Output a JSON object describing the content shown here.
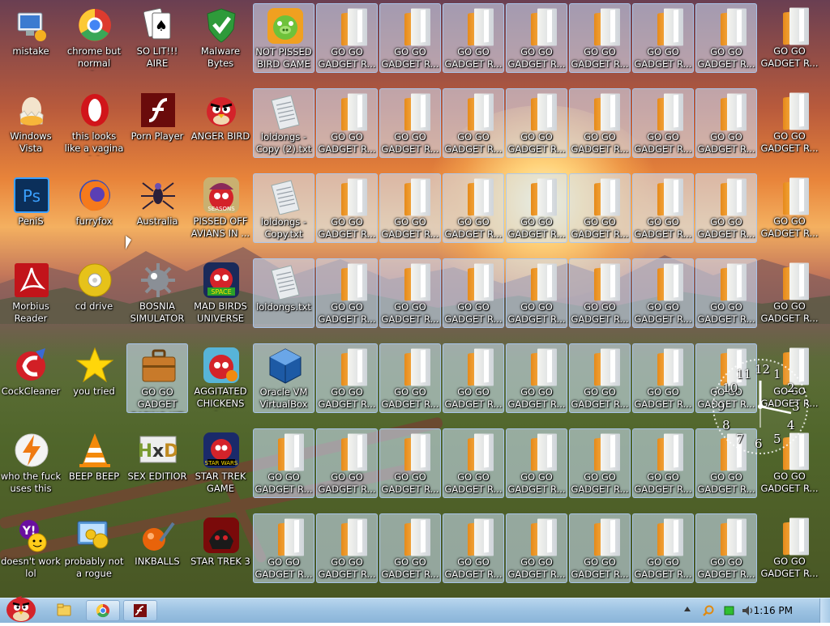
{
  "desktop": {
    "left_icons": [
      {
        "label": "mistake",
        "icon": "computer-icon"
      },
      {
        "label": "chrome but normal colors",
        "icon": "chrome-icon"
      },
      {
        "label": "SO LIT!!! AIRE",
        "icon": "solitaire-icon"
      },
      {
        "label": "Malware Bytes",
        "icon": "shield-icon"
      },
      {
        "label": "Windows Vista",
        "icon": "egg-icon"
      },
      {
        "label": "this looks like a vagina lol",
        "icon": "opera-icon"
      },
      {
        "label": "Porn Player",
        "icon": "flash-icon"
      },
      {
        "label": "ANGER BIRD",
        "icon": "angry-bird-icon"
      },
      {
        "label": "PeniS",
        "icon": "photoshop-icon"
      },
      {
        "label": "furryfox",
        "icon": "firefox-icon"
      },
      {
        "label": "Australia",
        "icon": "spider-icon"
      },
      {
        "label": "PISSED OFF AVIANS IN ...",
        "icon": "angry-birds-seasons-icon"
      },
      {
        "label": "Morbius Reader",
        "icon": "pdf-icon"
      },
      {
        "label": "cd drive",
        "icon": "cd-icon"
      },
      {
        "label": "BOSNIA SIMULATOR",
        "icon": "mine-icon"
      },
      {
        "label": "MAD BIRDS UNIVERSE",
        "icon": "angry-birds-space-icon"
      },
      {
        "label": "CockCleaner",
        "icon": "ccleaner-icon"
      },
      {
        "label": "you tried",
        "icon": "star-icon"
      },
      {
        "label": "GO GO GADGET RAPING KIT",
        "icon": "briefcase-icon"
      },
      {
        "label": "AGGITATED CHICKENS I...",
        "icon": "angry-birds-rio-icon"
      },
      {
        "label": "who the fuck uses this",
        "icon": "winamp-icon"
      },
      {
        "label": "BEEP BEEP",
        "icon": "vlc-icon"
      },
      {
        "label": "SEX EDITIOR",
        "icon": "hxd-icon"
      },
      {
        "label": "STAR TREK GAME",
        "icon": "angry-birds-star-wars-icon"
      },
      {
        "label": "doesn't work lol",
        "icon": "yahoo-icon"
      },
      {
        "label": "probably not a rogue",
        "icon": "settings-icon"
      },
      {
        "label": "INKBALLS",
        "icon": "inkball-icon"
      },
      {
        "label": "STAR TREK 3",
        "icon": "angry-birds-star-wars-2-icon"
      }
    ],
    "special_icons": [
      {
        "label": "NOT PISSED BIRD GAME",
        "icon": "bad-piggies-icon"
      },
      {
        "label": "loldongs - Copy (2).txt",
        "icon": "text-file-icon"
      },
      {
        "label": "loldongs - Copy.txt",
        "icon": "text-file-icon"
      },
      {
        "label": "loldongs.txt",
        "icon": "text-file-icon"
      },
      {
        "label": "Oracle VM VirtualBox",
        "icon": "virtualbox-icon"
      }
    ],
    "folder_label": "GO GO GADGET R...",
    "clock_numbers": [
      "12",
      "1",
      "2",
      "3",
      "4",
      "5",
      "6",
      "7",
      "8",
      "9",
      "10",
      "11"
    ]
  },
  "taskbar": {
    "start": "start-orb-angry-bird",
    "pinned": [
      "explorer-icon",
      "chrome-icon",
      "flash-icon"
    ],
    "tray": [
      "show-hidden-icons",
      "search-icon",
      "battery-icon",
      "volume-icon"
    ],
    "time": "1:16 PM"
  }
}
